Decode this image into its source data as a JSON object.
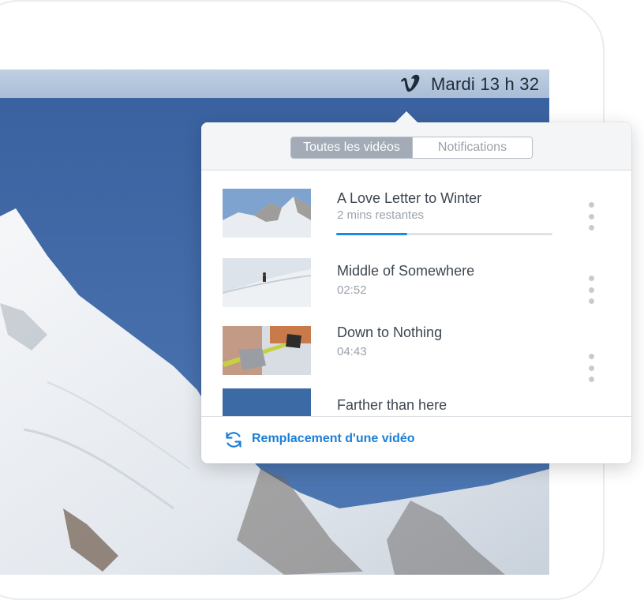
{
  "menubar": {
    "clock": "Mardi 13 h 32",
    "logo_icon": "vimeo-logo-icon"
  },
  "popover": {
    "tabs": [
      {
        "label": "Toutes les vidéos",
        "active": true
      },
      {
        "label": "Notifications",
        "active": false
      }
    ],
    "videos": [
      {
        "title": "A Love Letter to Winter",
        "subtitle": "2 mins restantes",
        "progress": 0.33,
        "thumbnail": "snowy-mountain-ridge"
      },
      {
        "title": "Middle of Somewhere",
        "subtitle": "02:52",
        "thumbnail": "skier-on-slope"
      },
      {
        "title": "Down to Nothing",
        "subtitle": "04:43",
        "thumbnail": "gloved-hand-on-ski-pole"
      },
      {
        "title": "Farther than here",
        "subtitle": "",
        "thumbnail": "blue-sky"
      }
    ],
    "footer": {
      "label": "Remplacement d'une vidéo",
      "icon": "refresh-icon"
    }
  },
  "colors": {
    "accent": "#1a8ae6",
    "footer_text": "#1a7fd6",
    "sky": "#3e6aa6",
    "menubar": "#b4c6dc"
  }
}
